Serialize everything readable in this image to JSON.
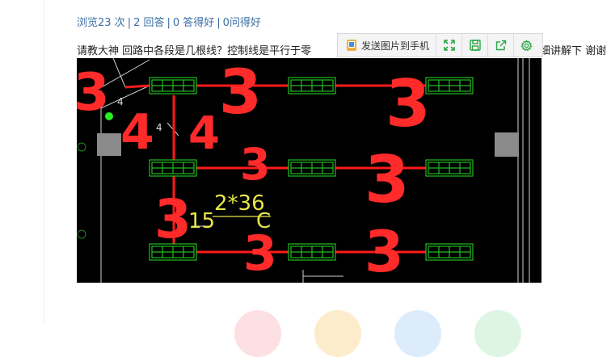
{
  "stats": {
    "views": "浏览23 次",
    "answers": "2 回答",
    "good_answers": "0 答得好",
    "good_questions": "0问得好",
    "separator": "|"
  },
  "question": {
    "text": "请教大神  回路中各段是几根线？控制线是平行于零",
    "tail": "细讲解下  谢谢"
  },
  "image_toolbar": {
    "send_label": "发送图片到手机"
  },
  "cad_image": {
    "handwritten_labels": [
      "3",
      "4",
      "3",
      "3",
      "4",
      "3",
      "3",
      "3",
      "3",
      "3"
    ],
    "drawing_labels": [
      "4",
      "4",
      "2*36",
      "15",
      "C"
    ],
    "colors": {
      "wire": "#ff1a1a",
      "fixture": "#22bb22",
      "background": "#000000",
      "ink": "#ff2a2a"
    }
  },
  "colors": {
    "link": "#3a6ea5",
    "circle_1": "#fde0e3",
    "circle_2": "#fdeccb",
    "circle_3": "#dcecfb",
    "circle_4": "#dff5e3"
  }
}
